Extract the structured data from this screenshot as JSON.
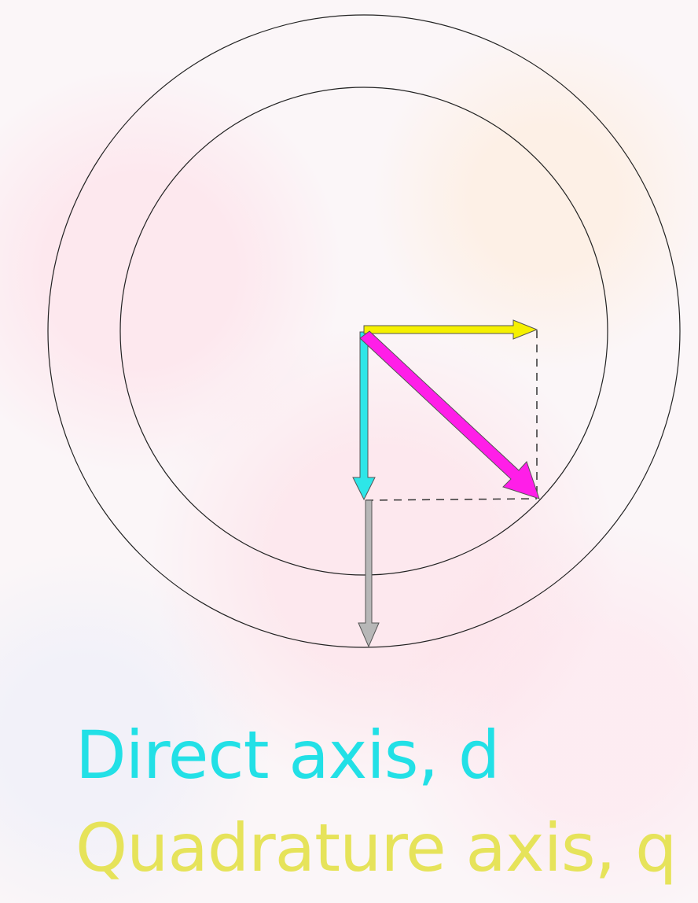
{
  "labels": {
    "direct_axis": "Direct axis, d",
    "quadrature_axis": "Quadrature axis, q"
  },
  "colors": {
    "direct_axis": "#22e0e6",
    "quadrature_axis": "#e6e35a",
    "d_vector": "#2ee6e8",
    "q_vector": "#f5f000",
    "resultant_vector": "#ff1ee8",
    "reference_vector": "#b7b7b7",
    "circles": "#222222",
    "projection_lines": "#333333"
  },
  "icons": {
    "d_vector": "d-axis-arrow-icon",
    "q_vector": "q-axis-arrow-icon",
    "resultant_vector": "resultant-arrow-icon",
    "reference_vector": "reference-arrow-icon"
  }
}
